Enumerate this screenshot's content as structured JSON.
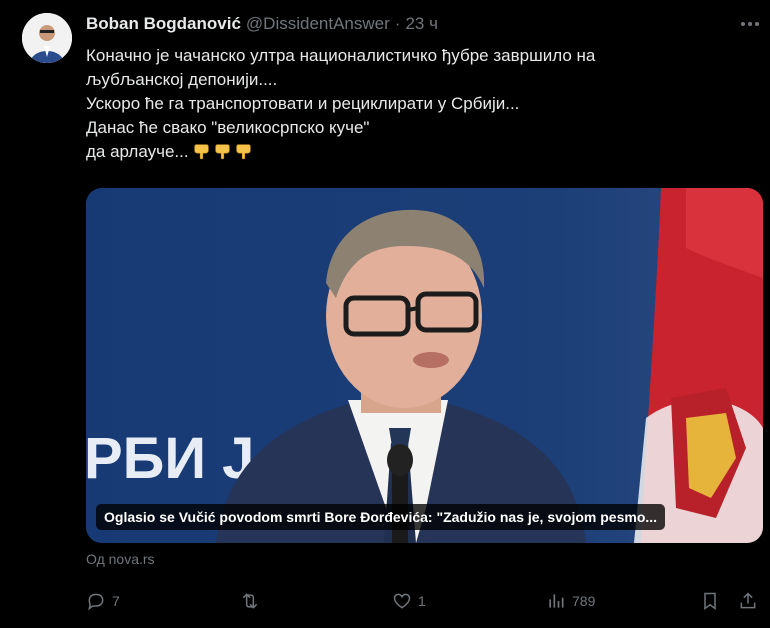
{
  "post": {
    "author_name": "Boban Bogdanović",
    "handle": "@DissidentAnswer",
    "separator": "·",
    "time": "23 ч",
    "lines": [
      "Коначно је чачанско ултра националистичко ђубре завршило на",
      "љубљанској депонији....",
      "Ускоро ће га транспортовати и рециклирати у Србији...",
      "Данас ће свако \"великосрпско куче\"",
      "да арлауче..."
    ],
    "emoji_icon": "pointing-down-icon",
    "emoji_count": 3
  },
  "card": {
    "backdrop_text": "РБИ Ј",
    "caption": "Oglasio se Vučić povodom smrti Bore Đorđevića: \"Zadužio nas je, svojom pesmo...",
    "source": "Од nova.rs"
  },
  "actions": {
    "replies": "7",
    "reposts": "",
    "likes": "1",
    "views": "789"
  },
  "colors": {
    "background": "#000000",
    "text": "#e7e9ea",
    "muted": "#71767b"
  }
}
